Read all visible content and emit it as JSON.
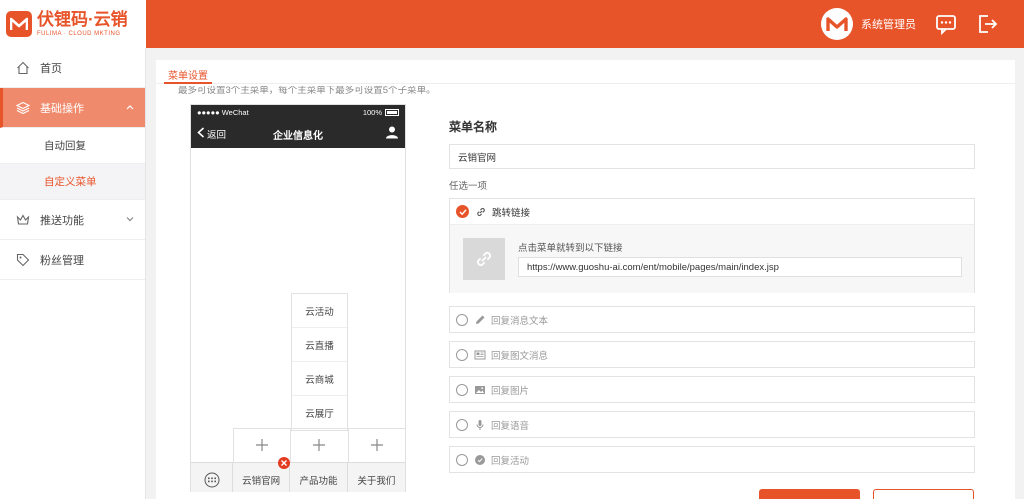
{
  "app": {
    "logo_title": "伏锂码·云销",
    "logo_subtitle": "FULIMA · CLOUD MKTING",
    "username": "系统管理员"
  },
  "sidebar": {
    "items": [
      {
        "label": "首页"
      },
      {
        "label": "基础操作",
        "expanded": true
      },
      {
        "label": "推送功能"
      },
      {
        "label": "粉丝管理"
      }
    ],
    "sub_items": [
      {
        "label": "自动回复"
      },
      {
        "label": "自定义菜单"
      }
    ]
  },
  "tabs": [
    {
      "label": "菜单设置"
    }
  ],
  "hint": "最多可设置3个主菜单，每个主菜单下最多可设置5个子菜单。",
  "phone": {
    "carrier": "●●●●● WeChat",
    "battery": "100%",
    "back": "返回",
    "title": "企业信息化",
    "submenu": [
      "云活动",
      "云直播",
      "云商城",
      "云展厅"
    ],
    "menus": [
      "云销官网",
      "产品功能",
      "关于我们"
    ]
  },
  "form": {
    "name_label": "菜单名称",
    "name_value": "云销官网",
    "choose_label": "任选一项",
    "options": [
      {
        "label": "跳转链接",
        "selected": true
      },
      {
        "label": "回复消息文本"
      },
      {
        "label": "回复图文消息"
      },
      {
        "label": "回复图片"
      },
      {
        "label": "回复语音"
      },
      {
        "label": "回复活动"
      }
    ],
    "link_desc": "点击菜单就转到以下链接",
    "link_url": "https://www.guoshu-ai.com/ent/mobile/pages/main/index.jsp"
  },
  "colors": {
    "accent": "#e8542a",
    "sidebar_active": "#f08a6c"
  }
}
